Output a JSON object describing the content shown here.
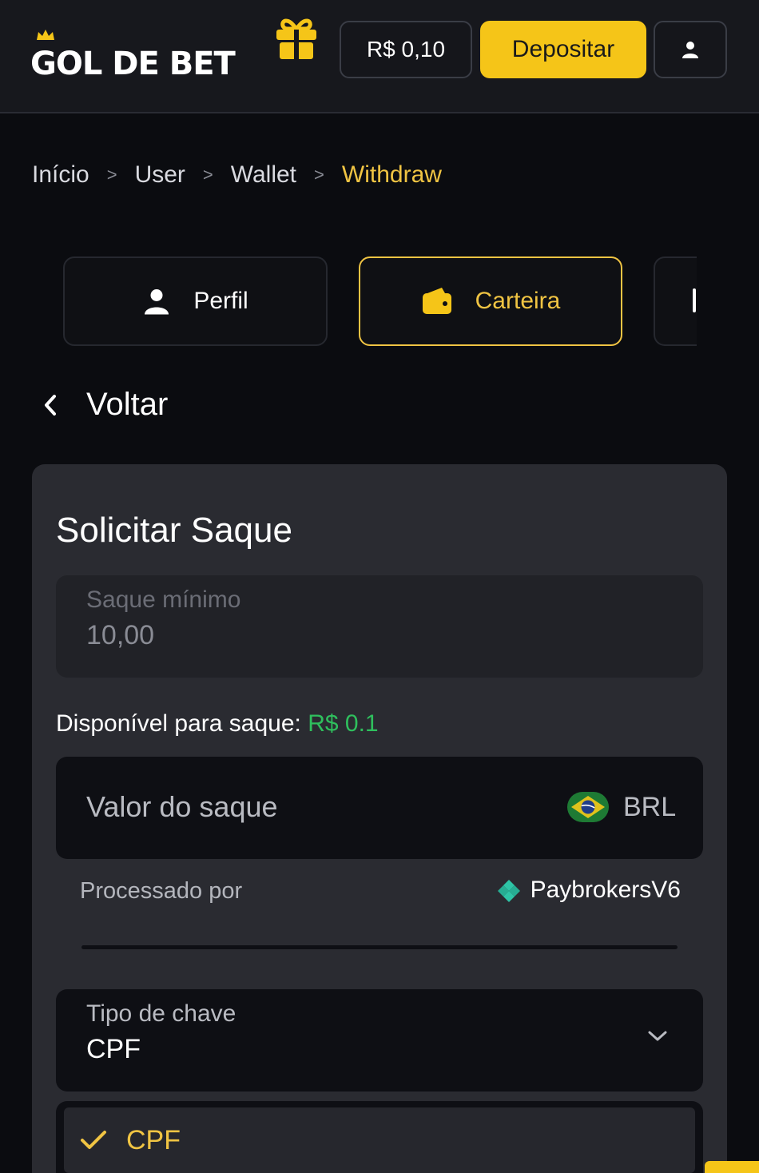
{
  "header": {
    "logo_text": "GOL DE BET",
    "balance": "R$ 0,10",
    "deposit_label": "Depositar"
  },
  "breadcrumb": {
    "items": [
      "Início",
      "User",
      "Wallet"
    ],
    "separator": ">",
    "current": "Withdraw"
  },
  "tabs": [
    {
      "label": "Perfil",
      "icon": "user-icon",
      "active": false
    },
    {
      "label": "Carteira",
      "icon": "wallet-icon",
      "active": true
    }
  ],
  "back": {
    "label": "Voltar"
  },
  "withdraw": {
    "title": "Solicitar Saque",
    "min_label": "Saque mínimo",
    "min_value": "10,00",
    "available_label": "Disponível para saque:",
    "available_amount": "R$ 0.1",
    "amount_placeholder": "Valor do saque",
    "currency": "BRL",
    "processed_label": "Processado por",
    "provider": "PaybrokersV6",
    "key_type_label": "Tipo de chave",
    "key_type_value": "CPF",
    "options": [
      "CPF"
    ]
  },
  "colors": {
    "accent": "#f5c518",
    "accent_text": "#f0c443",
    "success": "#2fbf5d",
    "background": "#0b0c10",
    "card": "#2a2b31"
  }
}
